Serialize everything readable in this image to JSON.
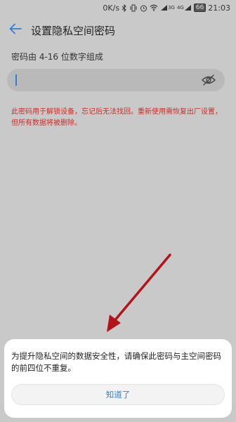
{
  "status_bar": {
    "network_speed": "0K/s",
    "net_type_1": "3G",
    "net_type_2": "4G",
    "battery": "66",
    "time": "21:03"
  },
  "header": {
    "title": "设置隐私空间密码"
  },
  "form": {
    "hint": "密码由 4-16 位数字组成",
    "password_value": "",
    "warning": "此密码用于解锁设备，忘记后无法找回。重新使用需恢复出厂设置，但所有数据将被删除。"
  },
  "dialog": {
    "message": "为提升隐私空间的数据安全性，请确保此密码与主空间密码的前四位不重复。",
    "ok_label": "知道了"
  },
  "colors": {
    "accent": "#2f7fd6",
    "warning": "#c8302c",
    "annotation_arrow": "#b3141a",
    "dim_background": "#c9c9c9"
  },
  "icons": {
    "back": "arrow-left-icon",
    "eye": "eye-off-icon"
  }
}
